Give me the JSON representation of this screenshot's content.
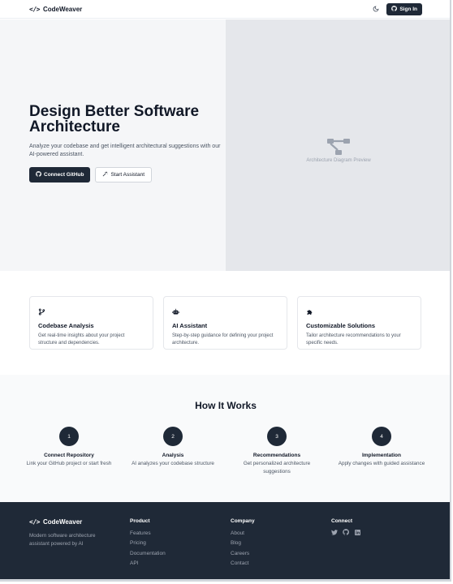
{
  "header": {
    "brand_mark": "</>",
    "brand_name": "CodeWeaver",
    "theme_toggle_icon": "moon-icon",
    "signin_label": "Sign In"
  },
  "hero": {
    "title_line1": "Design Better Software",
    "title_line2": "Architecture",
    "subtitle": "Analyze your codebase and get intelligent architectural suggestions with our AI-powered assistant.",
    "connect_label": "Connect GitHub",
    "assistant_label": "Start Assistant",
    "preview_label": "Architecture Diagram Preview"
  },
  "features": [
    {
      "icon": "git-branch-icon",
      "title": "Codebase Analysis",
      "desc": "Get real-time insights about your project structure and dependencies."
    },
    {
      "icon": "bot-icon",
      "title": "AI Assistant",
      "desc": "Step-by-step guidance for defining your project architecture."
    },
    {
      "icon": "puzzle-icon",
      "title": "Customizable Solutions",
      "desc": "Tailor architecture recommendations to your specific needs."
    }
  ],
  "how": {
    "title": "How It Works",
    "steps": [
      {
        "num": "1",
        "title": "Connect Repository",
        "desc": "Link your GitHub project or start fresh"
      },
      {
        "num": "2",
        "title": "Analysis",
        "desc": "AI analyzes your codebase structure"
      },
      {
        "num": "3",
        "title": "Recommendations",
        "desc": "Get personalized architecture suggestions"
      },
      {
        "num": "4",
        "title": "Implementation",
        "desc": "Apply changes with guided assistance"
      }
    ]
  },
  "footer": {
    "brand_mark": "</>",
    "brand_name": "CodeWeaver",
    "tagline": "Modern software architecture assistant powered by AI",
    "product": {
      "heading": "Product",
      "links": [
        "Features",
        "Pricing",
        "Documentation",
        "API"
      ]
    },
    "company": {
      "heading": "Company",
      "links": [
        "About",
        "Blog",
        "Careers",
        "Contact"
      ]
    },
    "connect": {
      "heading": "Connect",
      "icons": [
        "twitter-icon",
        "github-icon",
        "linkedin-icon"
      ]
    }
  },
  "colors": {
    "primary": "#1f2937",
    "hero_bg": "#f5f6f8",
    "preview_bg": "#e5e7eb",
    "footer_bg": "#1f2937"
  }
}
